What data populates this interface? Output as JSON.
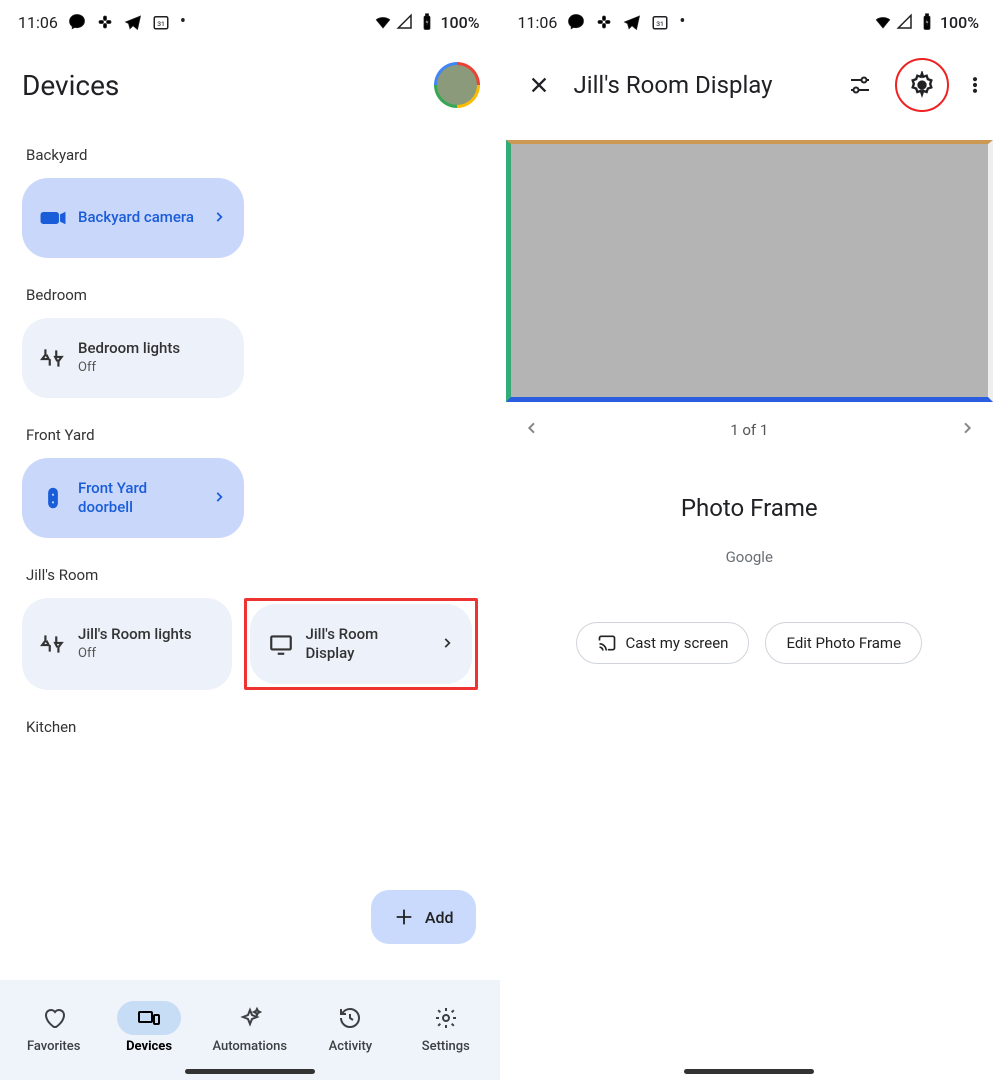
{
  "status": {
    "time": "11:06",
    "battery": "100%"
  },
  "screen1": {
    "title": "Devices",
    "rooms": {
      "backyard": {
        "label": "Backyard",
        "camera": "Backyard camera"
      },
      "bedroom": {
        "label": "Bedroom",
        "lights": "Bedroom lights",
        "lights_state": "Off"
      },
      "frontyard": {
        "label": "Front Yard",
        "doorbell": "Front Yard doorbell"
      },
      "jillsroom": {
        "label": "Jill's Room",
        "lights": "Jill's Room lights",
        "lights_state": "Off",
        "display": "Jill's Room Display"
      },
      "kitchen": {
        "label": "Kitchen"
      }
    },
    "fab": "Add",
    "nav": {
      "favorites": "Favorites",
      "devices": "Devices",
      "automations": "Automations",
      "activity": "Activity",
      "settings": "Settings"
    }
  },
  "screen2": {
    "title": "Jill's Room Display",
    "pager": "1 of 1",
    "device_name": "Photo Frame",
    "brand": "Google",
    "cast": "Cast my screen",
    "edit": "Edit Photo Frame"
  }
}
